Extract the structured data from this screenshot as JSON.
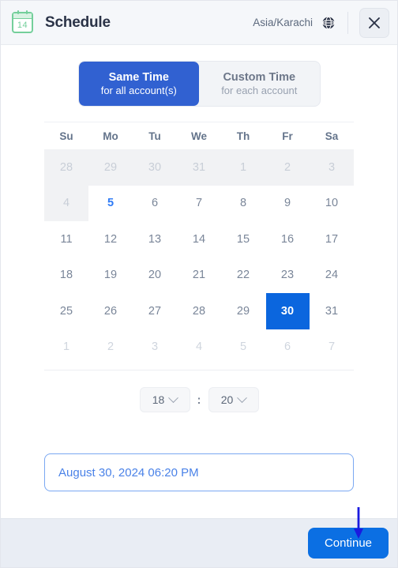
{
  "header": {
    "icon_name": "calendar-icon",
    "icon_day": "14",
    "title": "Schedule",
    "timezone": "Asia/Karachi",
    "globe_icon": "globe-icon",
    "close_icon": "close-icon"
  },
  "mode_toggle": {
    "options": [
      {
        "main": "Same Time",
        "sub": "for all account(s)",
        "active": true
      },
      {
        "main": "Custom Time",
        "sub": "for each account",
        "active": false
      }
    ]
  },
  "calendar": {
    "weekdays": [
      "Su",
      "Mo",
      "Tu",
      "We",
      "Th",
      "Fr",
      "Sa"
    ],
    "weeks": [
      [
        {
          "d": "28",
          "state": "disabled"
        },
        {
          "d": "29",
          "state": "disabled"
        },
        {
          "d": "30",
          "state": "disabled"
        },
        {
          "d": "31",
          "state": "disabled"
        },
        {
          "d": "1",
          "state": "disabled"
        },
        {
          "d": "2",
          "state": "disabled"
        },
        {
          "d": "3",
          "state": "disabled"
        }
      ],
      [
        {
          "d": "4",
          "state": "disabled"
        },
        {
          "d": "5",
          "state": "today"
        },
        {
          "d": "6",
          "state": "normal"
        },
        {
          "d": "7",
          "state": "normal"
        },
        {
          "d": "8",
          "state": "normal"
        },
        {
          "d": "9",
          "state": "normal"
        },
        {
          "d": "10",
          "state": "normal"
        }
      ],
      [
        {
          "d": "11",
          "state": "normal"
        },
        {
          "d": "12",
          "state": "normal"
        },
        {
          "d": "13",
          "state": "normal"
        },
        {
          "d": "14",
          "state": "normal"
        },
        {
          "d": "15",
          "state": "normal"
        },
        {
          "d": "16",
          "state": "normal"
        },
        {
          "d": "17",
          "state": "normal"
        }
      ],
      [
        {
          "d": "18",
          "state": "normal"
        },
        {
          "d": "19",
          "state": "normal"
        },
        {
          "d": "20",
          "state": "normal"
        },
        {
          "d": "21",
          "state": "normal"
        },
        {
          "d": "22",
          "state": "normal"
        },
        {
          "d": "23",
          "state": "normal"
        },
        {
          "d": "24",
          "state": "normal"
        }
      ],
      [
        {
          "d": "25",
          "state": "normal"
        },
        {
          "d": "26",
          "state": "normal"
        },
        {
          "d": "27",
          "state": "normal"
        },
        {
          "d": "28",
          "state": "normal"
        },
        {
          "d": "29",
          "state": "normal"
        },
        {
          "d": "30",
          "state": "selected"
        },
        {
          "d": "31",
          "state": "normal"
        }
      ],
      [
        {
          "d": "1",
          "state": "dim"
        },
        {
          "d": "2",
          "state": "dim"
        },
        {
          "d": "3",
          "state": "dim"
        },
        {
          "d": "4",
          "state": "dim"
        },
        {
          "d": "5",
          "state": "dim"
        },
        {
          "d": "6",
          "state": "dim"
        },
        {
          "d": "7",
          "state": "dim"
        }
      ]
    ]
  },
  "time": {
    "hour": "18",
    "minute": "20",
    "separator": ":"
  },
  "summary": {
    "value": "August 30, 2024 06:20 PM"
  },
  "footer": {
    "continue_label": "Continue"
  },
  "annotation": {
    "arrow_color": "#1a1ae0",
    "arrow_name": "pointer-arrow"
  },
  "colors": {
    "accent_blue": "#0b66de",
    "toggle_blue": "#3161d1",
    "footer_bg": "#e9edf4",
    "header_bg": "#f5f7fa",
    "green_icon": "#74cf9b"
  }
}
